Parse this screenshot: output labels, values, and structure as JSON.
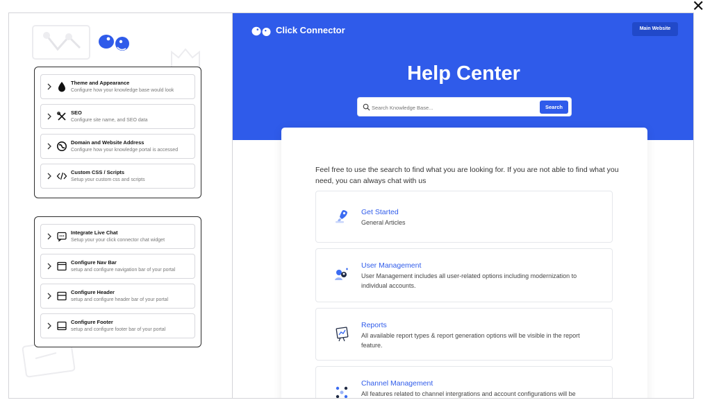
{
  "window": {
    "close_glyph": "✕"
  },
  "left_panel": {
    "logo_icon": "click-connector-logo",
    "groups": [
      {
        "items": [
          {
            "title": "Theme and Appearance",
            "subtitle": "Configure how your knowledge base would look",
            "icon": "droplet-icon"
          },
          {
            "title": "SEO",
            "subtitle": "Configure site name, and SEO data",
            "icon": "tools-icon"
          },
          {
            "title": "Domain and Website Address",
            "subtitle": "Configure how your knowledge portal is accessed",
            "icon": "globe-icon"
          },
          {
            "title": "Custom CSS / Scripts",
            "subtitle": "Setup your custom css and scripts",
            "icon": "code-icon"
          }
        ]
      },
      {
        "items": [
          {
            "title": "Integrate Live Chat",
            "subtitle": "Setup your your click connector chat widget",
            "icon": "chat-icon"
          },
          {
            "title": "Configure Nav Bar",
            "subtitle": "setup and configure navigation bar of your portal",
            "icon": "navbar-icon"
          },
          {
            "title": "Configure Header",
            "subtitle": "setup and configure header bar of your portal",
            "icon": "header-icon"
          },
          {
            "title": "Configure Footer",
            "subtitle": "setup and configure footer bar of your portal",
            "icon": "footer-icon"
          }
        ]
      }
    ]
  },
  "preview": {
    "brand": "Click Connector",
    "main_website_label": "Main Website",
    "hero_title": "Help Center",
    "search": {
      "placeholder": "Search Knowledge Base...",
      "button_label": "Search"
    },
    "intro_text": "Feel free to use the search to find what you are looking for. If you are not able to find what you need, you can always chat with us",
    "categories": [
      {
        "title": "Get Started",
        "description": "General Articles",
        "icon": "rocket-icon"
      },
      {
        "title": "User Management",
        "description": "User Management includes all user-related options including modernization to individual accounts.",
        "icon": "users-icon"
      },
      {
        "title": "Reports",
        "description": "All available report types & report generation options will be visible in the report feature.",
        "icon": "report-icon"
      },
      {
        "title": "Channel Management",
        "description": "All features related to channel intergrations and account configurations will be",
        "icon": "channels-icon"
      }
    ]
  },
  "colors": {
    "primary": "#2f5bea",
    "button_dark": "#2149c9",
    "text_dark": "#111111",
    "muted": "#777777"
  }
}
